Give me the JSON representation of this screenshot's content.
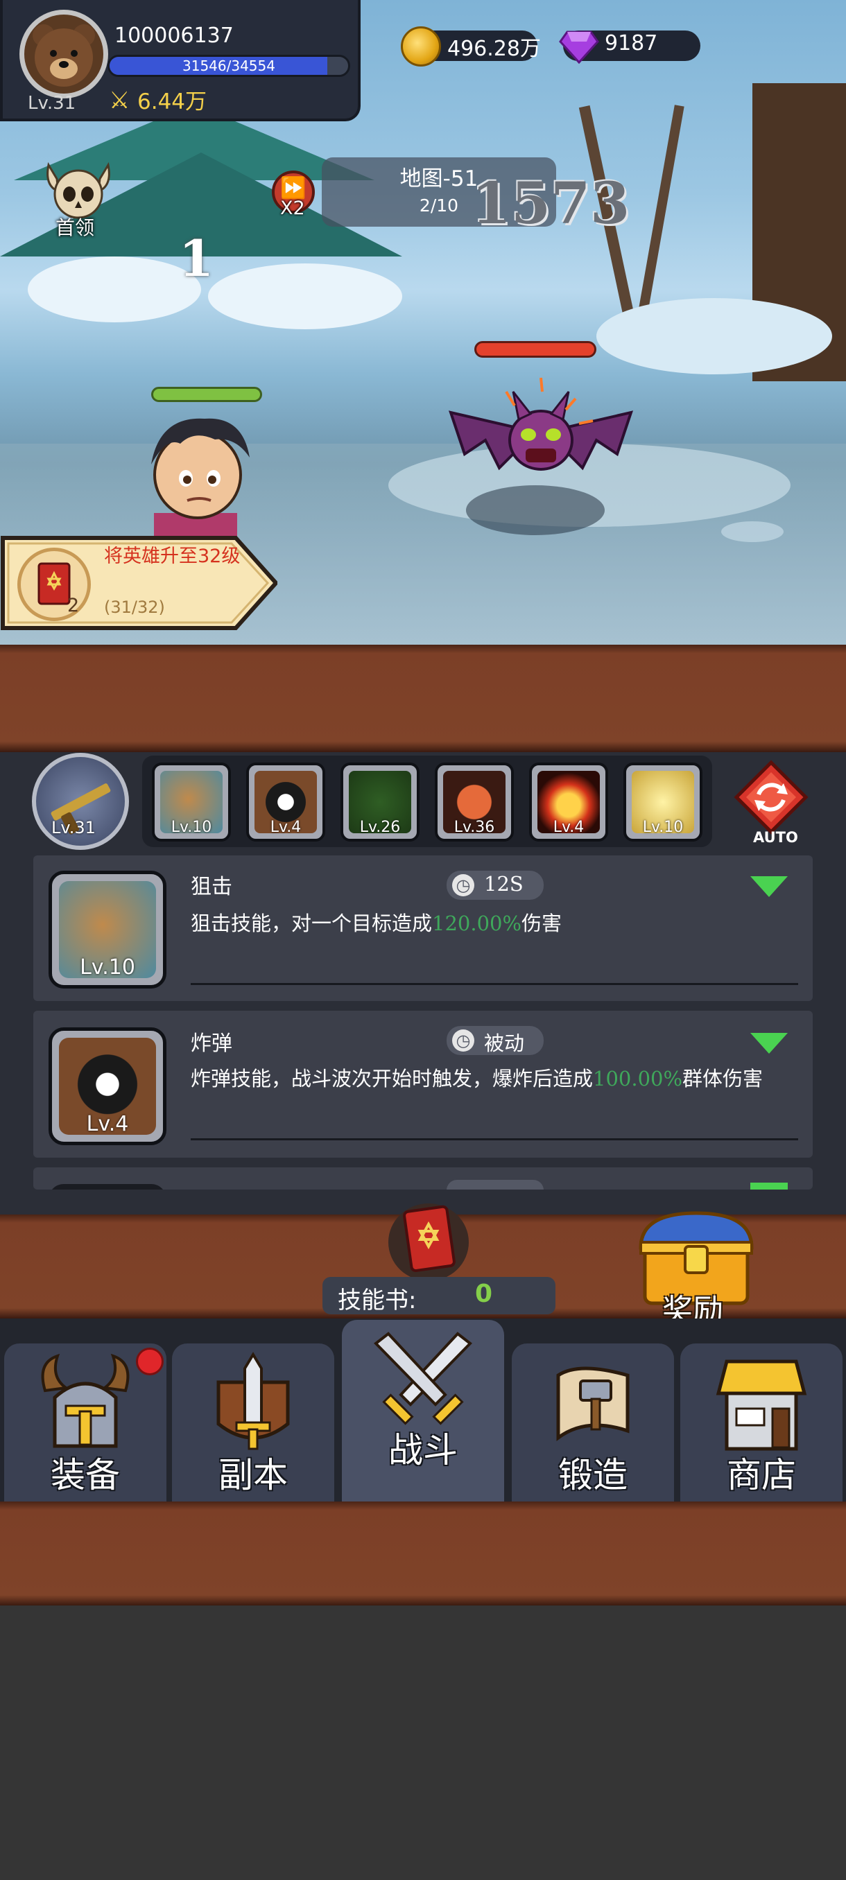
{
  "player": {
    "id": "100006137",
    "level": "Lv.31",
    "xp_text": "31546/34554",
    "xp_fraction": 0.913,
    "power": "6.44万",
    "coins": "496.28万",
    "gems": "9187"
  },
  "battle": {
    "boss_label": "首领",
    "speed_label": "X2",
    "map_title": "地图-51",
    "wave": "2/10",
    "damage_popup": "1573",
    "combo": "1",
    "hero_hp_fraction": 1.0,
    "enemy_hp_fraction": 0.85
  },
  "quest": {
    "text": "将英雄升至32级",
    "progress": "(31/32)",
    "count": "2"
  },
  "weapon": {
    "level": "Lv.31"
  },
  "skill_slots": [
    {
      "level": "Lv.10",
      "icon": "sniper-icon"
    },
    {
      "level": "Lv.4",
      "icon": "bomb-icon"
    },
    {
      "level": "Lv.26",
      "icon": "poison-icon"
    },
    {
      "level": "Lv.36",
      "icon": "fire-orb-icon"
    },
    {
      "level": "Lv.4",
      "icon": "sunset-icon"
    },
    {
      "level": "Lv.10",
      "icon": "lightning-icon"
    }
  ],
  "auto_label": "AUTO",
  "skills": [
    {
      "name": "狙击",
      "level": "Lv.10",
      "cooldown": "12S",
      "desc_pre": "狙击技能，对一个目标造成",
      "desc_value": "120.00%",
      "desc_post": "伤害"
    },
    {
      "name": "炸弹",
      "level": "Lv.4",
      "cooldown": "被动",
      "desc_pre": "炸弹技能，战斗波次开始时触发，爆炸后造成",
      "desc_value": "100.00%",
      "desc_post": "群体伤害"
    }
  ],
  "skill_book": {
    "label": "技能书:",
    "count": "0"
  },
  "reward_label": "奖励",
  "nav": [
    {
      "label": "装备",
      "icon": "helmet-icon"
    },
    {
      "label": "副本",
      "icon": "dungeon-sword-icon"
    },
    {
      "label": "战斗",
      "icon": "crossed-swords-icon"
    },
    {
      "label": "锻造",
      "icon": "forge-scroll-icon"
    },
    {
      "label": "商店",
      "icon": "shop-icon"
    }
  ],
  "colors": {
    "accent_green": "#3fa85b",
    "quest_red": "#d5321e",
    "gold": "#f4d04a",
    "xp_blue": "#3955d6"
  }
}
